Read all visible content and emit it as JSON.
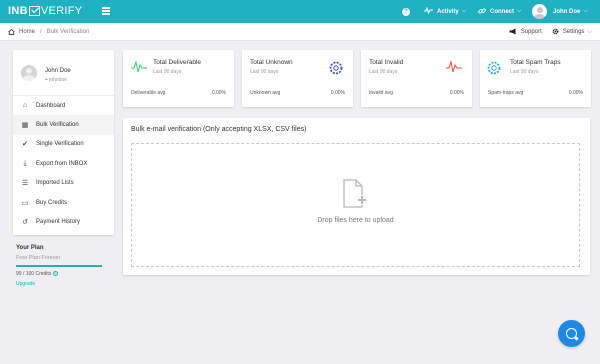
{
  "app": {
    "logo_left": "INB",
    "logo_right": "VERIFY",
    "brand_color": "#1fb1c2"
  },
  "topnav": {
    "activity": "Activity",
    "connect": "Connect",
    "user": "John Doe"
  },
  "breadcrumb": {
    "home": "Home",
    "current": "Bulk Verification"
  },
  "header_links": {
    "support": "Support",
    "settings": "Settings"
  },
  "sidebar": {
    "profile_name": "John Doe",
    "profile_meta": "johndoe",
    "items": [
      {
        "label": "Dashboard",
        "icon": "home-icon"
      },
      {
        "label": "Bulk Verification",
        "icon": "table-icon"
      },
      {
        "label": "Single Verification",
        "icon": "check-icon"
      },
      {
        "label": "Export from INBOX",
        "icon": "download-tray-icon"
      },
      {
        "label": "Imported Lists",
        "icon": "list-icon"
      },
      {
        "label": "Buy Credits",
        "icon": "credit-card-icon"
      },
      {
        "label": "Payment History",
        "icon": "history-icon"
      }
    ]
  },
  "plan": {
    "title": "Your Plan",
    "name": "Free Plan Forever",
    "credits": "99 / 100 Credits",
    "credits_used_fraction": 0.99,
    "upgrade": "Upgrade"
  },
  "stats": [
    {
      "title": "Total Deliverable",
      "sub": "Last 90 days",
      "foot_label": "Deliverable avg",
      "foot_value": "0.00%",
      "icon": "pulse-icon",
      "color": "#2ecc71"
    },
    {
      "title": "Total Unknown",
      "sub": "Last 90 days",
      "foot_label": "Unknown avg",
      "foot_value": "0.00%",
      "icon": "gear-icon",
      "color": "#3f51b5"
    },
    {
      "title": "Total Invalid",
      "sub": "Last 90 days",
      "foot_label": "Invalid avg",
      "foot_value": "0.00%",
      "icon": "pulse-icon",
      "color": "#e74c3c"
    },
    {
      "title": "Total Spam Traps",
      "sub": "Last 90 days",
      "foot_label": "Spam-traps avg",
      "foot_value": "0.00%",
      "icon": "gear-icon",
      "color": "#29a9e1"
    }
  ],
  "upload": {
    "title": "Bulk e-mail verification (Only accepting XLSX, CSV files)",
    "drop_text": "Drop files here to upload"
  }
}
